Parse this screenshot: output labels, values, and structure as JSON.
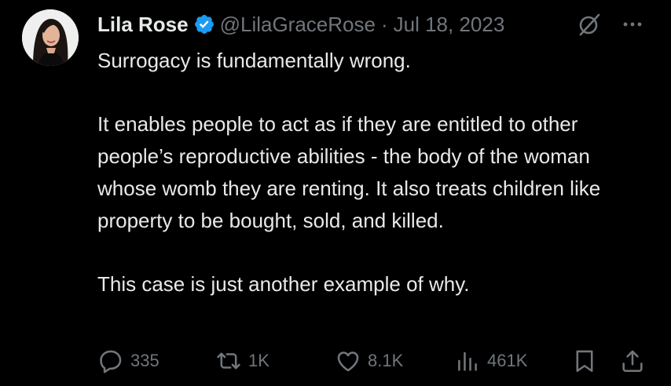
{
  "author": {
    "name": "Lila Rose",
    "handle": "@LilaGraceRose",
    "separator": "·",
    "date": "Jul 18, 2023"
  },
  "tweet": {
    "paragraphs": [
      "Surrogacy is fundamentally wrong.",
      "It enables people to act as if they are entitled to other people’s reproductive abilities - the body of the woman whose womb they are renting. It also treats children like property to be bought, sold, and killed.",
      "This case is just another example of why."
    ]
  },
  "metrics": {
    "replies": "335",
    "retweets": "1K",
    "likes": "8.1K",
    "views": "461K"
  },
  "icons": {
    "verified": "verified-badge-icon",
    "grok": "grok-icon",
    "more": "more-icon",
    "reply": "reply-icon",
    "retweet": "retweet-icon",
    "like": "heart-icon",
    "views": "views-icon",
    "bookmark": "bookmark-icon",
    "share": "share-icon"
  },
  "colors": {
    "background": "#000000",
    "text": "#e7e9ea",
    "muted": "#71767b",
    "verified": "#1d9bf0"
  }
}
